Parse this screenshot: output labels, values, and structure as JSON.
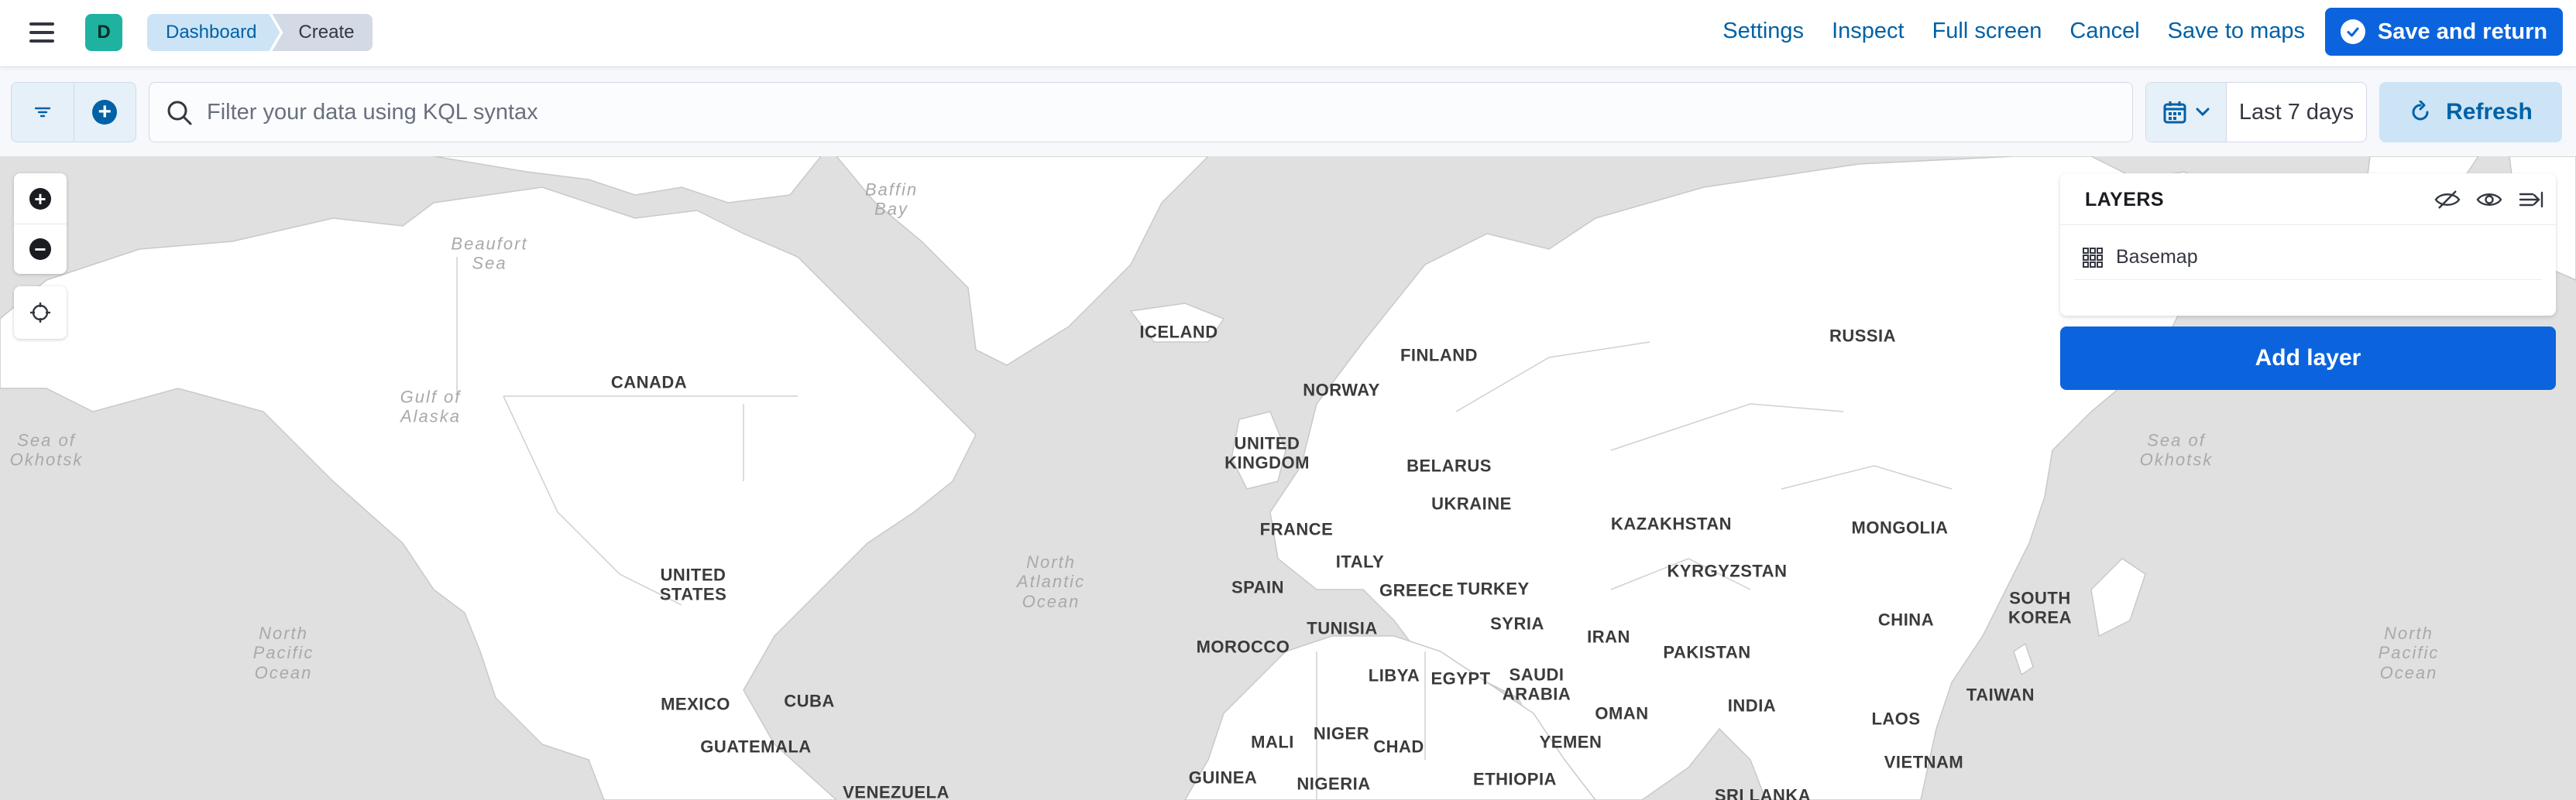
{
  "header": {
    "space_initial": "D",
    "breadcrumbs": [
      {
        "label": "Dashboard"
      },
      {
        "label": "Create"
      }
    ],
    "links": {
      "settings": "Settings",
      "inspect": "Inspect",
      "full_screen": "Full screen",
      "cancel": "Cancel",
      "save_to_maps": "Save to maps"
    },
    "save_return_label": "Save and return"
  },
  "query_bar": {
    "search_placeholder": "Filter your data using KQL syntax",
    "date_range": "Last 7 days",
    "refresh_label": "Refresh"
  },
  "layers_panel": {
    "title": "LAYERS",
    "layers": [
      {
        "name": "Basemap",
        "icon": "grid-icon"
      }
    ],
    "add_layer_label": "Add layer"
  },
  "map": {
    "country_labels": {
      "canada": "CANADA",
      "united_states": "UNITED\nSTATES",
      "mexico": "MEXICO",
      "cuba": "CUBA",
      "guatemala": "GUATEMALA",
      "venezuela": "VENEZUELA",
      "iceland": "ICELAND",
      "finland": "FINLAND",
      "norway": "NORWAY",
      "united_kingdom": "UNITED\nKINGDOM",
      "belarus": "BELARUS",
      "ukraine": "UKRAINE",
      "france": "FRANCE",
      "italy": "ITALY",
      "spain": "SPAIN",
      "greece": "GREECE",
      "turkey": "TURKEY",
      "tunisia": "TUNISIA",
      "morocco": "MOROCCO",
      "syria": "SYRIA",
      "libya": "LIBYA",
      "egypt": "EGYPT",
      "saudi_arabia": "SAUDI\nARABIA",
      "iran": "IRAN",
      "russia": "RUSSIA",
      "kazakhstan": "KAZAKHSTAN",
      "kyrgyzstan": "KYRGYZSTAN",
      "mongolia": "MONGOLIA",
      "china": "CHINA",
      "south_korea": "SOUTH\nKOREA",
      "pakistan": "PAKISTAN",
      "india": "INDIA",
      "oman": "OMAN",
      "yemen": "YEMEN",
      "mali": "MALI",
      "niger": "NIGER",
      "chad": "CHAD",
      "nigeria": "NIGERIA",
      "guinea": "GUINEA",
      "ethiopia": "ETHIOPIA",
      "laos": "LAOS",
      "vietnam": "VIETNAM",
      "taiwan": "TAIWAN",
      "sri_lanka": "SRI LANKA"
    },
    "ocean_labels": {
      "baffin_bay": "Baffin\nBay",
      "beaufort_sea": "Beaufort\nSea",
      "gulf_of_alaska": "Gulf of\nAlaska",
      "sea_of_okhotsk_left": "Sea of\nOkhotsk",
      "sea_of_okhotsk_right": "Sea of\nOkhotsk",
      "north_atlantic": "North\nAtlantic\nOcean",
      "north_pacific_left": "North\nPacific\nOcean",
      "north_pacific_right": "North\nPacific\nOcean"
    }
  },
  "colors": {
    "primary": "#0b64dd",
    "link": "#0061a6",
    "land": "#ffffff",
    "water": "#e0e0e0",
    "space_avatar": "#20b2a0"
  }
}
